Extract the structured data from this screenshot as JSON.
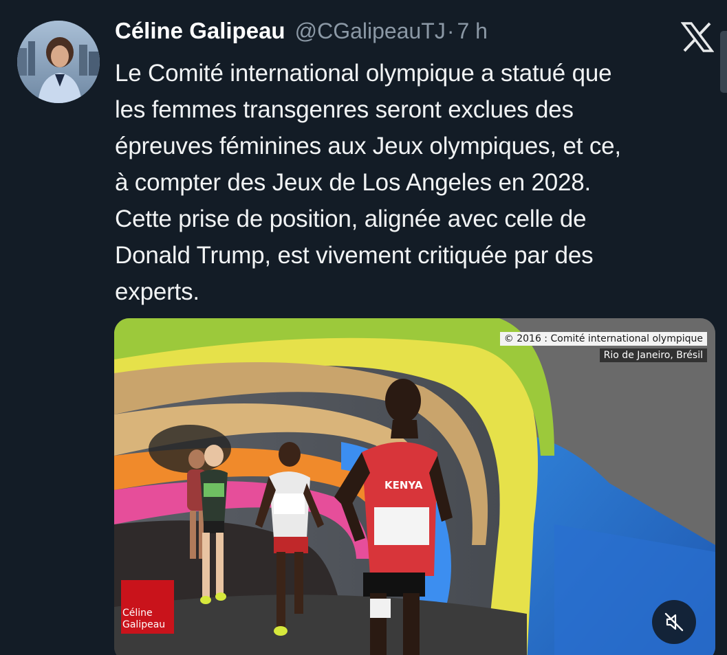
{
  "tweet": {
    "author": {
      "display_name": "Céline Galipeau",
      "handle": "@CGalipeauTJ",
      "separator": "·",
      "time": "7 h"
    },
    "text_lines": [
      "Le Comité international olympique a statué que",
      "les femmes transgenres seront exclues des",
      "épreuves féminines aux Jeux olympiques, et ce,",
      "à compter des Jeux de Los Angeles en 2028.",
      "Cette prise de position, alignée avec celle de",
      "Donald Trump, est vivement critiquée par des",
      "experts."
    ],
    "platform_icon": "x-logo-icon"
  },
  "media": {
    "copyright": "© 2016 : Comité international olympique",
    "location": "Rio de Janeiro, Brésil",
    "watermark": {
      "line1": "Céline",
      "line2": "Galipeau",
      "color": "#c9131b"
    },
    "bib_text": "KENYA",
    "mute_icon": "speaker-muted-icon"
  },
  "colors": {
    "background": "#131c26",
    "secondary_text": "#8b98a5",
    "primary_text": "#f1f3f4"
  }
}
